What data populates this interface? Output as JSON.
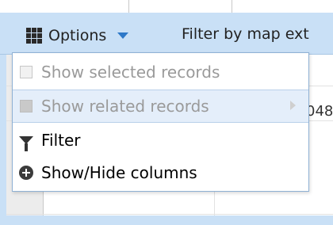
{
  "toolbar": {
    "options_label": "Options",
    "filter_by_map_extent": "Filter by map ext"
  },
  "grid": {
    "visible_cell_value": "048"
  },
  "menu": {
    "items": [
      {
        "label": "Show selected records",
        "icon": "checkbox-icon",
        "state": "disabled"
      },
      {
        "label": "Show related records",
        "icon": "square-icon",
        "state": "disabled-hover",
        "has_submenu": true
      },
      {
        "label": "Filter",
        "icon": "funnel-icon",
        "state": "enabled"
      },
      {
        "label": "Show/Hide columns",
        "icon": "plus-circle-icon",
        "state": "enabled"
      }
    ]
  },
  "colors": {
    "toolbar_bg": "#c9e0f6",
    "menu_border": "#8fb1d4",
    "hover_bg": "#e4eefa",
    "disabled_text": "#9a9a9a",
    "caret": "#2d78c8"
  }
}
